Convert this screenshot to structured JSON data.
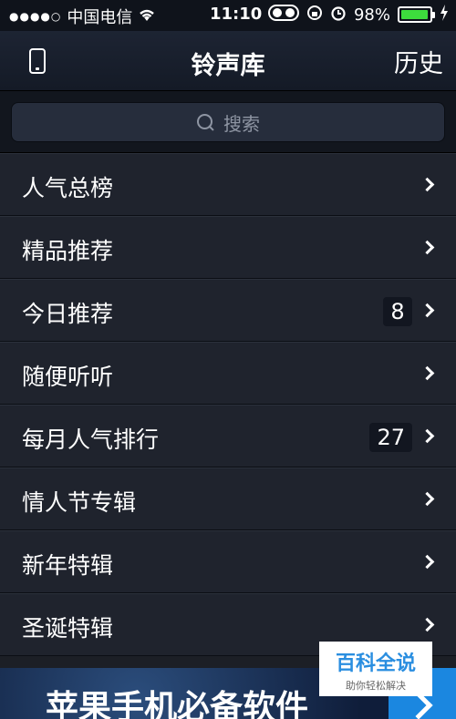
{
  "status": {
    "carrier": "中国电信",
    "time": "11:10",
    "battery": "98%",
    "battery_level": 0.98,
    "signal_dots": "●●●●○",
    "wifi_icon": "wifi-icon"
  },
  "nav": {
    "title": "铃声库",
    "history": "历史"
  },
  "search": {
    "placeholder": "搜索"
  },
  "list": {
    "items": [
      {
        "label": "人气总榜",
        "badge": ""
      },
      {
        "label": "精品推荐",
        "badge": ""
      },
      {
        "label": "今日推荐",
        "badge": "8"
      },
      {
        "label": "随便听听",
        "badge": ""
      },
      {
        "label": "每月人气排行",
        "badge": "27"
      },
      {
        "label": "情人节专辑",
        "badge": ""
      },
      {
        "label": "新年特辑",
        "badge": ""
      },
      {
        "label": "圣诞特辑",
        "badge": ""
      }
    ]
  },
  "banner": {
    "text": "苹果手机必备软件"
  },
  "watermark": {
    "title": "百科全说",
    "subtitle": "助你轻松解决"
  },
  "colors": {
    "accent": "#1b87e0",
    "battery": "#3ddc3d",
    "watermark": "#2a8ee0"
  }
}
